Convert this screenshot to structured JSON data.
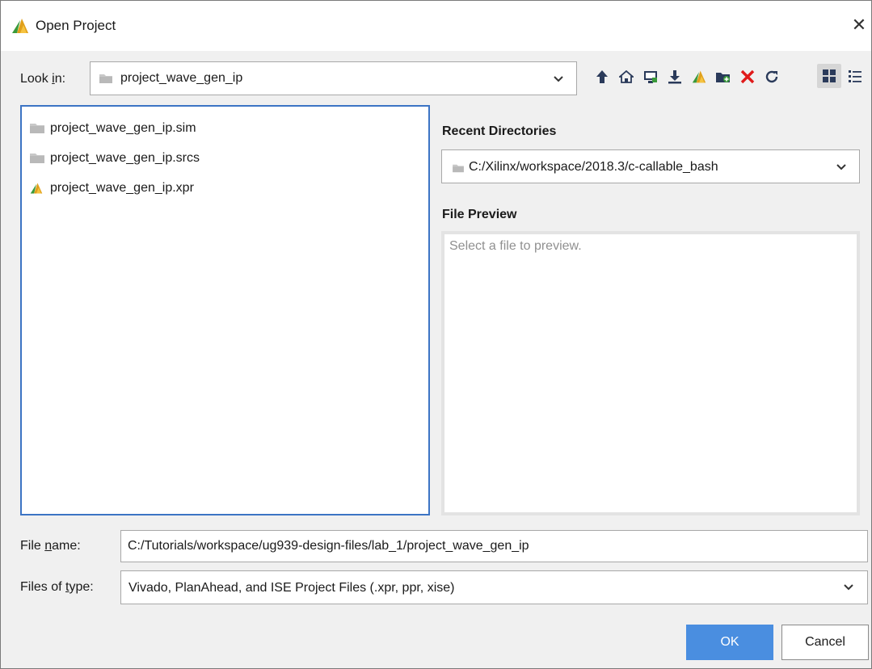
{
  "window": {
    "title": "Open Project",
    "close_icon": "close-icon"
  },
  "look_in": {
    "label_prefix": "Look ",
    "label_accel": "i",
    "label_suffix": "n:",
    "value": "project_wave_gen_ip"
  },
  "toolbar": {
    "icons": [
      "up-folder-icon",
      "home-icon",
      "desktop-icon",
      "download-icon",
      "vivado-project-icon",
      "new-folder-icon",
      "delete-icon",
      "refresh-icon",
      "grid-view-icon",
      "list-view-icon"
    ],
    "accent_delete": "#e01a1a",
    "accent_vivado": "#d9a21b",
    "accent_green": "#3a9a3a"
  },
  "files": {
    "items": [
      {
        "name": "project_wave_gen_ip.sim",
        "icon": "folder-icon"
      },
      {
        "name": "project_wave_gen_ip.srcs",
        "icon": "folder-icon"
      },
      {
        "name": "project_wave_gen_ip.xpr",
        "icon": "vivado-project-icon"
      }
    ]
  },
  "recent": {
    "label": "Recent Directories",
    "value": "C:/Xilinx/workspace/2018.3/c-callable_bash"
  },
  "preview": {
    "label": "File Preview",
    "placeholder": "Select a file to preview."
  },
  "file_name": {
    "label_prefix": "File ",
    "label_accel": "n",
    "label_suffix": "ame:",
    "value": "C:/Tutorials/workspace/ug939-design-files/lab_1/project_wave_gen_ip"
  },
  "file_type": {
    "label_prefix": "Files of ",
    "label_accel": "t",
    "label_suffix": "ype:",
    "value": "Vivado, PlanAhead, and ISE Project Files (.xpr, ppr, xise)"
  },
  "buttons": {
    "ok": "OK",
    "cancel": "Cancel"
  },
  "colors": {
    "ok_button": "#4a8ee0",
    "focus_border": "#3c74c4"
  }
}
